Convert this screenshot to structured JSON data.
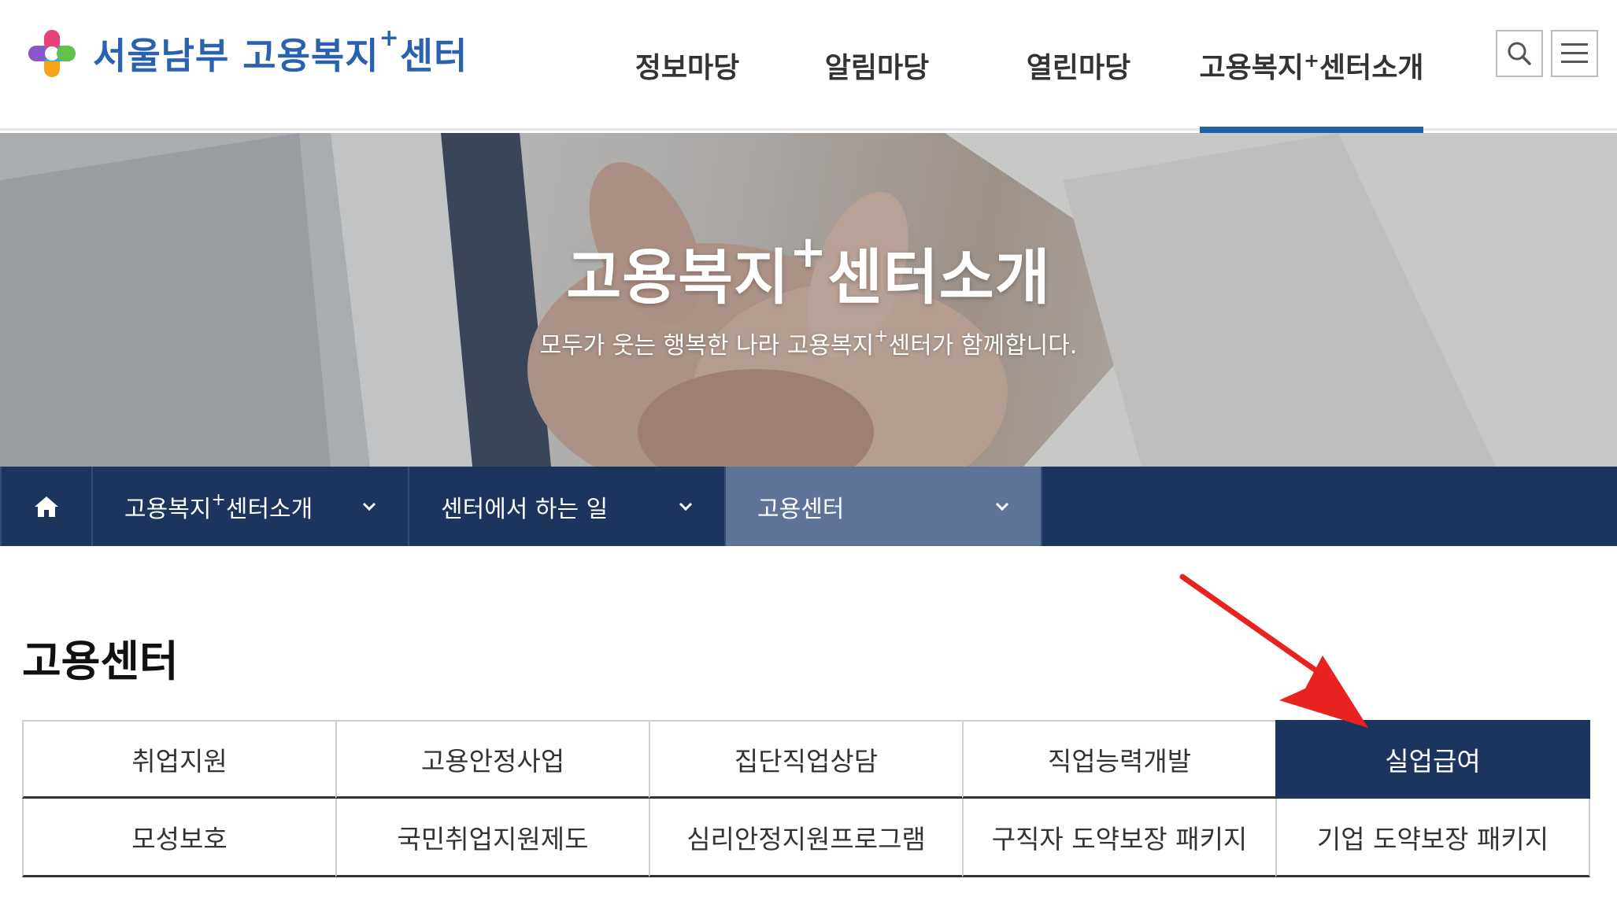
{
  "header": {
    "logo_text": "서울남부 고용복지",
    "logo_sup": "+",
    "logo_text_after": "센터",
    "nav": [
      {
        "label": "정보마당",
        "sup": "",
        "after": ""
      },
      {
        "label": "알림마당",
        "sup": "",
        "after": ""
      },
      {
        "label": "열린마당",
        "sup": "",
        "after": ""
      },
      {
        "label": "고용복지",
        "sup": "+",
        "after": "센터소개"
      }
    ],
    "search_icon": "search-icon",
    "menu_icon": "hamburger-menu-icon"
  },
  "hero": {
    "title": "고용복지",
    "title_sup": "+",
    "title_after": "센터소개",
    "subtitle": "모두가 웃는 행복한 나라 고용복지",
    "subtitle_sup": "+",
    "subtitle_after": "센터가 함께합니다."
  },
  "location": {
    "home_icon": "home-icon",
    "items": [
      {
        "label": "고용복지",
        "sup": "+",
        "after": "센터소개"
      },
      {
        "label": "센터에서 하는 일",
        "sup": "",
        "after": ""
      },
      {
        "label": "고용센터",
        "sup": "",
        "after": ""
      }
    ]
  },
  "main": {
    "title": "고용센터",
    "tabs_row1": [
      "취업지원",
      "고용안정사업",
      "집단직업상담",
      "직업능력개발",
      "실업급여"
    ],
    "tabs_row2": [
      "모성보호",
      "국민취업지원제도",
      "심리안정지원프로그램",
      "구직자 도약보장 패키지",
      "기업 도약보장 패키지"
    ],
    "active_tab": "실업급여"
  },
  "colors": {
    "brand_blue": "#2a62ad",
    "navy": "#1c355e",
    "active_location": "#5e7398",
    "nav_underline": "#1f5fa8",
    "annotation_red": "#e8231f"
  }
}
